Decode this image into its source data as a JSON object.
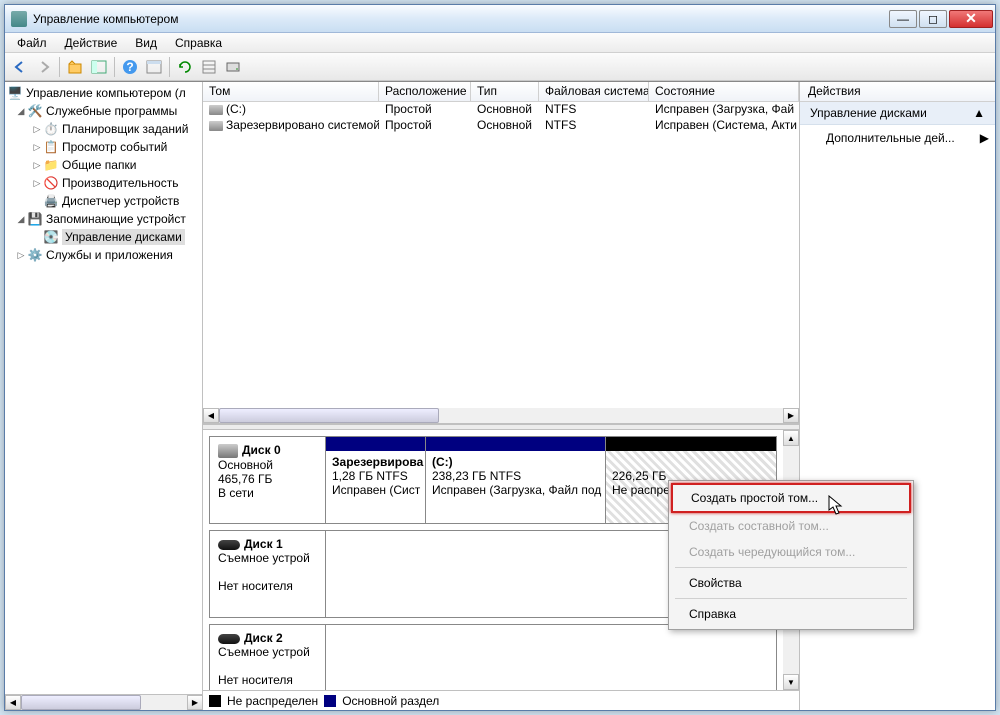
{
  "window": {
    "title": "Управление компьютером"
  },
  "menu": {
    "file": "Файл",
    "action": "Действие",
    "view": "Вид",
    "help": "Справка"
  },
  "tree": {
    "root": "Управление компьютером (л",
    "sys_tools": "Служебные программы",
    "scheduler": "Планировщик заданий",
    "events": "Просмотр событий",
    "shared": "Общие папки",
    "perf": "Производительность",
    "devmgr": "Диспетчер устройств",
    "storage": "Запоминающие устройст",
    "diskmgmt": "Управление дисками",
    "services": "Службы и приложения"
  },
  "cols": {
    "volume": "Том",
    "layout": "Расположение",
    "type": "Тип",
    "fs": "Файловая система",
    "status": "Состояние"
  },
  "col_widths": {
    "volume": 176,
    "layout": 92,
    "type": 68,
    "fs": 110,
    "status": 150
  },
  "vols": [
    {
      "name": "(C:)",
      "layout": "Простой",
      "type": "Основной",
      "fs": "NTFS",
      "status": "Исправен (Загрузка, Фай"
    },
    {
      "name": "Зарезервировано системой",
      "layout": "Простой",
      "type": "Основной",
      "fs": "NTFS",
      "status": "Исправен (Система, Акти"
    }
  ],
  "disk0": {
    "label": "Диск 0",
    "type": "Основной",
    "size": "465,76 ГБ",
    "online": "В сети",
    "p1": {
      "name": "Зарезервирова",
      "size": "1,28 ГБ NTFS",
      "status": "Исправен (Сист"
    },
    "p2": {
      "name": "(C:)",
      "size": "238,23 ГБ NTFS",
      "status": "Исправен (Загрузка, Файл под"
    },
    "p3": {
      "size": "226,25 ГБ",
      "status": "Не распределен"
    }
  },
  "disk1": {
    "label": "Диск 1",
    "type": "Съемное устрой",
    "nomedia": "Нет носителя"
  },
  "disk2": {
    "label": "Диск 2",
    "type": "Съемное устрой",
    "nomedia": "Нет носителя"
  },
  "legend": {
    "unalloc": "Не распределен",
    "primary": "Основной раздел"
  },
  "actions": {
    "header": "Действия",
    "section": "Управление дисками",
    "more": "Дополнительные дей..."
  },
  "ctx": {
    "simple": "Создать простой том...",
    "spanned": "Создать составной том...",
    "striped": "Создать чередующийся том...",
    "props": "Свойства",
    "help": "Справка"
  }
}
